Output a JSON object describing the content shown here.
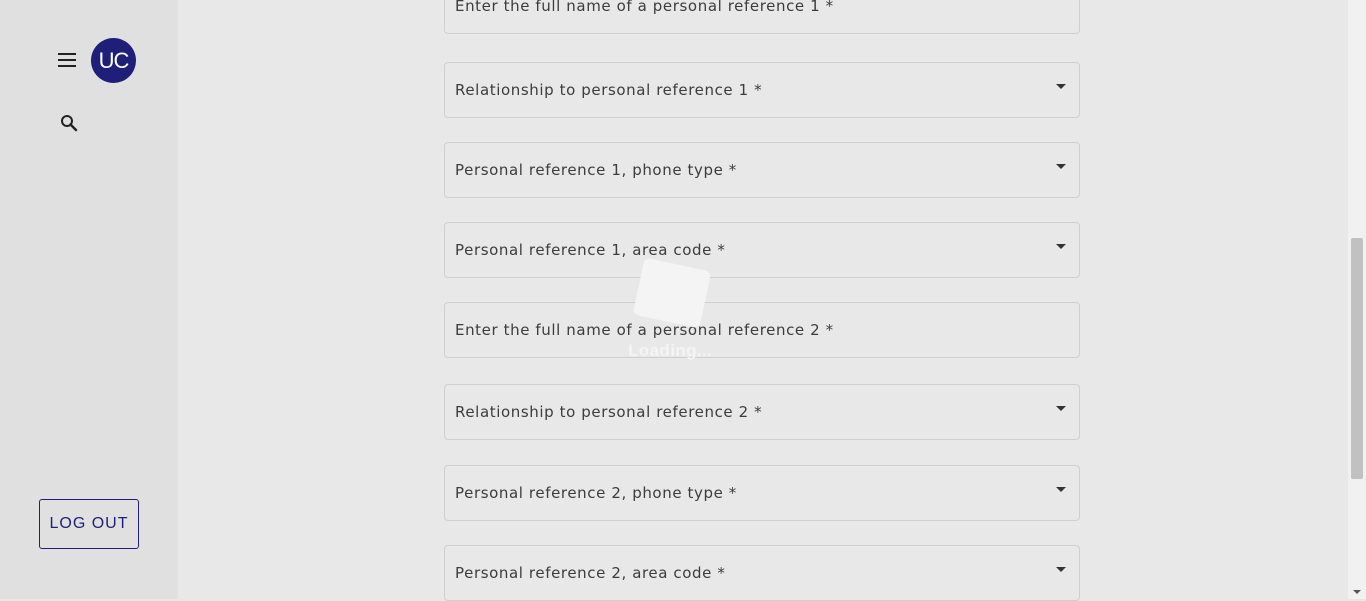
{
  "sidebar": {
    "menu_icon": "hamburger-menu-icon",
    "avatar_initials": "UC",
    "search_icon": "search-icon",
    "logout_label": "LOG OUT"
  },
  "form": {
    "fields": [
      {
        "label": "Enter the full name of a personal reference 1 *",
        "type": "text"
      },
      {
        "label": "Relationship to personal reference 1 *",
        "type": "select"
      },
      {
        "label": "Personal reference 1, phone type *",
        "type": "select"
      },
      {
        "label": "Personal reference 1, area code *",
        "type": "select"
      },
      {
        "label": "Enter the full name of a personal reference 2 *",
        "type": "text"
      },
      {
        "label": "Relationship to personal reference 2 *",
        "type": "select"
      },
      {
        "label": "Personal reference 2, phone type *",
        "type": "select"
      },
      {
        "label": "Personal reference 2, area code *",
        "type": "select"
      }
    ]
  },
  "overlay": {
    "loading_text": "Loading..."
  },
  "colors": {
    "brand": "#1f1f7a",
    "sidebar_bg": "#e0e0e0",
    "main_bg": "#e8e8e8",
    "field_border": "#cfcfcf"
  }
}
